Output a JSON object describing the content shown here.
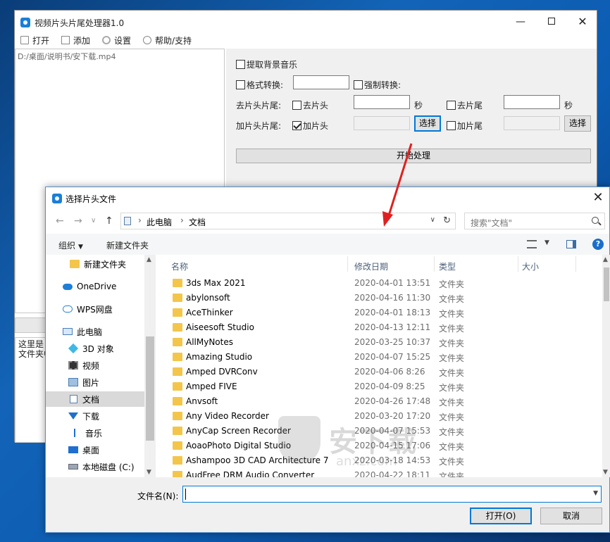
{
  "app": {
    "title": "视频片头片尾处理器1.0",
    "toolbar": [
      "打开",
      "添加",
      "设置",
      "帮助/支持"
    ],
    "file_list": [
      "D:/桌面/说明书/安下载.mp4"
    ],
    "log_lines": [
      "这里是日",
      "文件夹中"
    ],
    "options": {
      "extract_music": "提取背景音乐",
      "format_convert": "格式转换:",
      "force_convert": "强制转换:",
      "remove_label": "去片头片尾:",
      "remove_head": "去片头",
      "remove_tail": "去片尾",
      "seconds_unit": "秒",
      "add_label": "加片头片尾:",
      "add_head": "加片头",
      "add_tail": "加片尾",
      "choose": "选择",
      "start": "开始处理"
    }
  },
  "dialog": {
    "title": "选择片头文件",
    "breadcrumb": [
      "此电脑",
      "文档"
    ],
    "search_placeholder": "搜索\"文档\"",
    "commands": {
      "organize": "组织",
      "new_folder": "新建文件夹"
    },
    "nav_items": [
      {
        "label": "新建文件夹",
        "icon": "folder-icon"
      },
      {
        "label": "OneDrive",
        "icon": "onedrive-icon"
      },
      {
        "label": "WPS网盘",
        "icon": "wps-cloud-icon"
      },
      {
        "label": "此电脑",
        "icon": "computer-icon"
      },
      {
        "label": "3D 对象",
        "icon": "3d-objects-icon"
      },
      {
        "label": "视频",
        "icon": "video-icon"
      },
      {
        "label": "图片",
        "icon": "picture-icon"
      },
      {
        "label": "文档",
        "icon": "document-icon"
      },
      {
        "label": "下载",
        "icon": "download-icon"
      },
      {
        "label": "音乐",
        "icon": "music-icon"
      },
      {
        "label": "桌面",
        "icon": "desktop-icon"
      },
      {
        "label": "本地磁盘 (C:)",
        "icon": "disk-icon"
      }
    ],
    "columns": [
      "名称",
      "修改日期",
      "类型",
      "大小"
    ],
    "files": [
      {
        "name": "3ds Max 2021",
        "date": "2020-04-01 13:51",
        "type": "文件夹"
      },
      {
        "name": "abylonsoft",
        "date": "2020-04-16 11:30",
        "type": "文件夹"
      },
      {
        "name": "AceThinker",
        "date": "2020-04-01 18:13",
        "type": "文件夹"
      },
      {
        "name": "Aiseesoft Studio",
        "date": "2020-04-13 12:11",
        "type": "文件夹"
      },
      {
        "name": "AllMyNotes",
        "date": "2020-03-25 10:37",
        "type": "文件夹"
      },
      {
        "name": "Amazing Studio",
        "date": "2020-04-07 15:25",
        "type": "文件夹"
      },
      {
        "name": "Amped DVRConv",
        "date": "2020-04-06 8:26",
        "type": "文件夹"
      },
      {
        "name": "Amped FIVE",
        "date": "2020-04-09 8:25",
        "type": "文件夹"
      },
      {
        "name": "Anvsoft",
        "date": "2020-04-26 17:48",
        "type": "文件夹"
      },
      {
        "name": "Any Video Recorder",
        "date": "2020-03-20 17:20",
        "type": "文件夹"
      },
      {
        "name": "AnyCap Screen Recorder",
        "date": "2020-04-07 15:53",
        "type": "文件夹"
      },
      {
        "name": "AoaoPhoto Digital Studio",
        "date": "2020-04-15 17:06",
        "type": "文件夹"
      },
      {
        "name": "Ashampoo 3D CAD Architecture 7",
        "date": "2020-03-18 14:53",
        "type": "文件夹"
      },
      {
        "name": "AudFree DRM Audio Converter",
        "date": "2020-04-22 18:11",
        "type": "文件夹"
      }
    ],
    "filename_label": "文件名(N):",
    "filename_value": "",
    "open_button": "打开(O)",
    "cancel_button": "取消"
  },
  "watermark": {
    "text": "安下载",
    "sub": "anxz.com"
  },
  "colors": {
    "accent": "#0078d7",
    "arrow": "#e02020",
    "folder": "#f3c64b"
  }
}
